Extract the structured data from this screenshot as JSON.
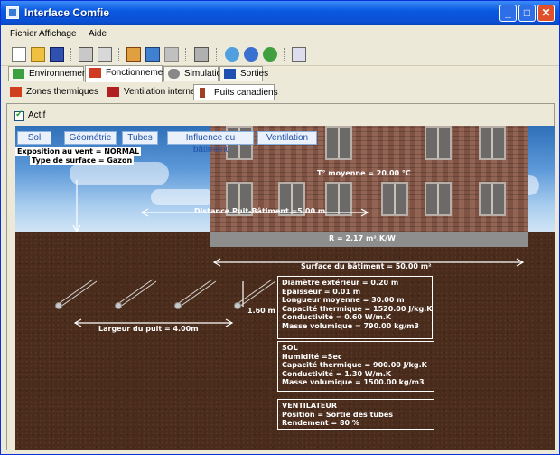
{
  "window": {
    "title": "Interface Comfie"
  },
  "menu": [
    "Fichier",
    "Affichage",
    "Aide"
  ],
  "main_tabs": [
    {
      "label": "Environnement",
      "active": false
    },
    {
      "label": "Fonctionnement",
      "active": true
    },
    {
      "label": "Simulation",
      "active": false
    },
    {
      "label": "Sorties",
      "active": false
    }
  ],
  "sub_tabs": [
    {
      "label": "Zones thermiques",
      "active": false
    },
    {
      "label": "Ventilation interne",
      "active": false
    },
    {
      "label": "Puits canadiens",
      "active": true
    }
  ],
  "actif": {
    "label": "Actif",
    "checked": true
  },
  "scene_tabs": [
    "Sol",
    "Géométrie",
    "Tubes",
    "Influence du bâtiment",
    "Ventilation"
  ],
  "labels": {
    "exposure": "Exposition au vent = NORMAL",
    "surface_type": "Type de surface = Gazon",
    "temperature": "T° moyenne = 20.00 °C",
    "distance": "Distance Puit-Bâtiment =5.00 m",
    "resistance": "R = 2.17 m².K/W",
    "building_surface": "Surface du bâtiment = 50.00 m²",
    "depth": "1.60 m",
    "width": "Largeur du puit = 4.00m"
  },
  "tube_box": [
    "Diamètre extérieur = 0.20 m",
    "Epaisseur = 0.01 m",
    "Longueur moyenne = 30.00 m",
    "Capacité thermique = 1520.00 J/kg.K",
    "Conductivité = 0.60 W/m.K",
    "Masse volumique = 790.00 kg/m3"
  ],
  "soil_box": [
    "SOL",
    "Humidité =Sec",
    "Capacité thermique = 900.00 J/kg.K",
    "Conductivité = 1.30 W/m.K",
    "Masse volumique = 1500.00 kg/m3"
  ],
  "fan_box": [
    "VENTILATEUR",
    "Position = Sortie des tubes",
    "Rendement = 80 %"
  ]
}
